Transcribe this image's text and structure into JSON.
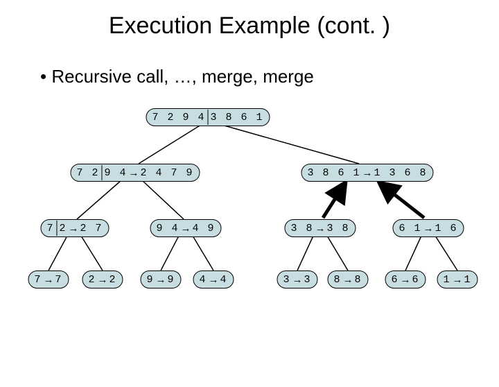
{
  "title": "Execution Example (cont. )",
  "bullet": "• Recursive call, …, merge, merge",
  "root": {
    "left": "7 2 9 4",
    "right": "3 8 6 1"
  },
  "level1": {
    "leftNode": {
      "a": "7 2",
      "b": "9 4",
      "res": "2 4 7 9"
    },
    "rightNode": {
      "a": "3 8 6 1",
      "res": "1 3 6 8"
    }
  },
  "level2": {
    "n0": {
      "a": "7",
      "b": "2",
      "res": "2 7"
    },
    "n1": {
      "a": "9 4",
      "res": "4 9"
    },
    "n2": {
      "a": "3 8",
      "res": "3 8"
    },
    "n3": {
      "a": "6 1",
      "res": "1 6"
    }
  },
  "leaves": {
    "l0": {
      "a": "7",
      "res": "7"
    },
    "l1": {
      "a": "2",
      "res": "2"
    },
    "l2": {
      "a": "9",
      "res": "9"
    },
    "l3": {
      "a": "4",
      "res": "4"
    },
    "l4": {
      "a": "3",
      "res": "3"
    },
    "l5": {
      "a": "8",
      "res": "8"
    },
    "l6": {
      "a": "6",
      "res": "6"
    },
    "l7": {
      "a": "1",
      "res": "1"
    }
  },
  "arrow": "→"
}
